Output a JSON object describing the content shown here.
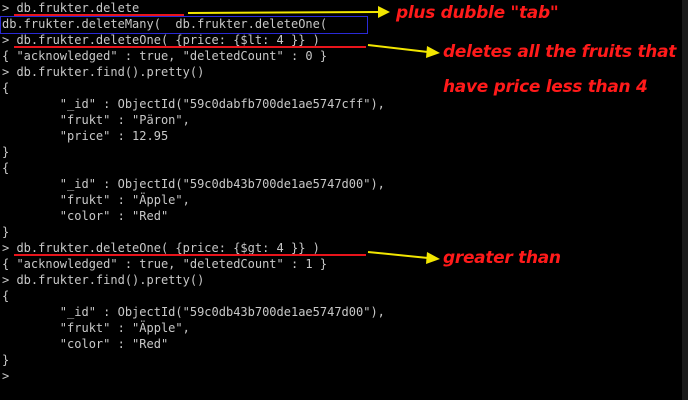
{
  "terminal": {
    "lines": [
      "> db.frukter.delete",
      "db.frukter.deleteMany(  db.frukter.deleteOne(",
      "> db.frukter.deleteOne( {price: {$lt: 4 }} )",
      "{ \"acknowledged\" : true, \"deletedCount\" : 0 }",
      "> db.frukter.find().pretty()",
      "{",
      "        \"_id\" : ObjectId(\"59c0dabfb700de1ae5747cff\"),",
      "        \"frukt\" : \"Päron\",",
      "        \"price\" : 12.95",
      "}",
      "{",
      "        \"_id\" : ObjectId(\"59c0db43b700de1ae5747d00\"),",
      "        \"frukt\" : \"Äpple\",",
      "        \"color\" : \"Red\"",
      "}",
      "> db.frukter.deleteOne( {price: {$gt: 4 }} )",
      "{ \"acknowledged\" : true, \"deletedCount\" : 1 }",
      "> db.frukter.find().pretty()",
      "{",
      "        \"_id\" : ObjectId(\"59c0db43b700de1ae5747d00\"),",
      "        \"frukt\" : \"Äpple\",",
      "        \"color\" : \"Red\"",
      "}",
      ">"
    ]
  },
  "annotations": {
    "tab_note": "plus dubble \"tab\"",
    "lt_note_line1": "deletes all the fruits that",
    "lt_note_line2": "have price less than 4",
    "gt_note": "greater than"
  },
  "colors": {
    "annotation_red": "#ff1a1a",
    "arrow_yellow": "#f2e600",
    "highlight_blue": "#2a2ad6",
    "terminal_text": "#c8c8c8",
    "terminal_bg": "#000000"
  }
}
